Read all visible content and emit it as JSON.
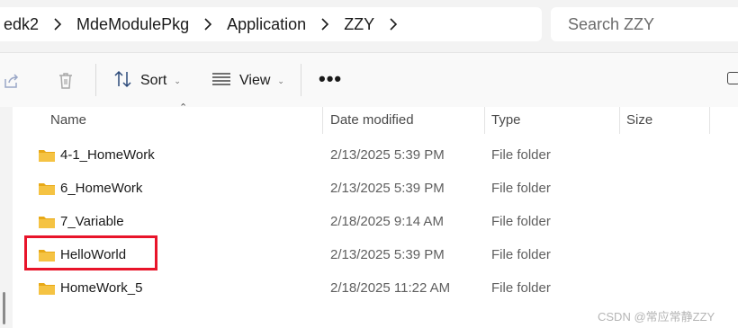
{
  "breadcrumb": {
    "segments": [
      "edk2",
      "MdeModulePkg",
      "Application",
      "ZZY"
    ]
  },
  "search": {
    "placeholder": "Search ZZY"
  },
  "toolbar": {
    "sort_label": "Sort",
    "view_label": "View",
    "more_label": "•••"
  },
  "columns": {
    "name": "Name",
    "date": "Date modified",
    "type": "Type",
    "size": "Size"
  },
  "files": [
    {
      "name": "4-1_HomeWork",
      "date": "2/13/2025 5:39 PM",
      "type": "File folder"
    },
    {
      "name": "6_HomeWork",
      "date": "2/13/2025 5:39 PM",
      "type": "File folder"
    },
    {
      "name": "7_Variable",
      "date": "2/18/2025 9:14 AM",
      "type": "File folder"
    },
    {
      "name": "HelloWorld",
      "date": "2/13/2025 5:39 PM",
      "type": "File folder"
    },
    {
      "name": "HomeWork_5",
      "date": "2/18/2025 11:22 AM",
      "type": "File folder"
    }
  ],
  "watermark": "CSDN @常应常静ZZY",
  "colors": {
    "highlight": "#e8142a",
    "folder": "#f5c343",
    "folder_dark": "#e8a917"
  },
  "icons": {
    "share": "share-icon",
    "delete": "trash-icon",
    "sort": "sort-icon",
    "view": "view-lines-icon",
    "folder": "folder-icon"
  }
}
